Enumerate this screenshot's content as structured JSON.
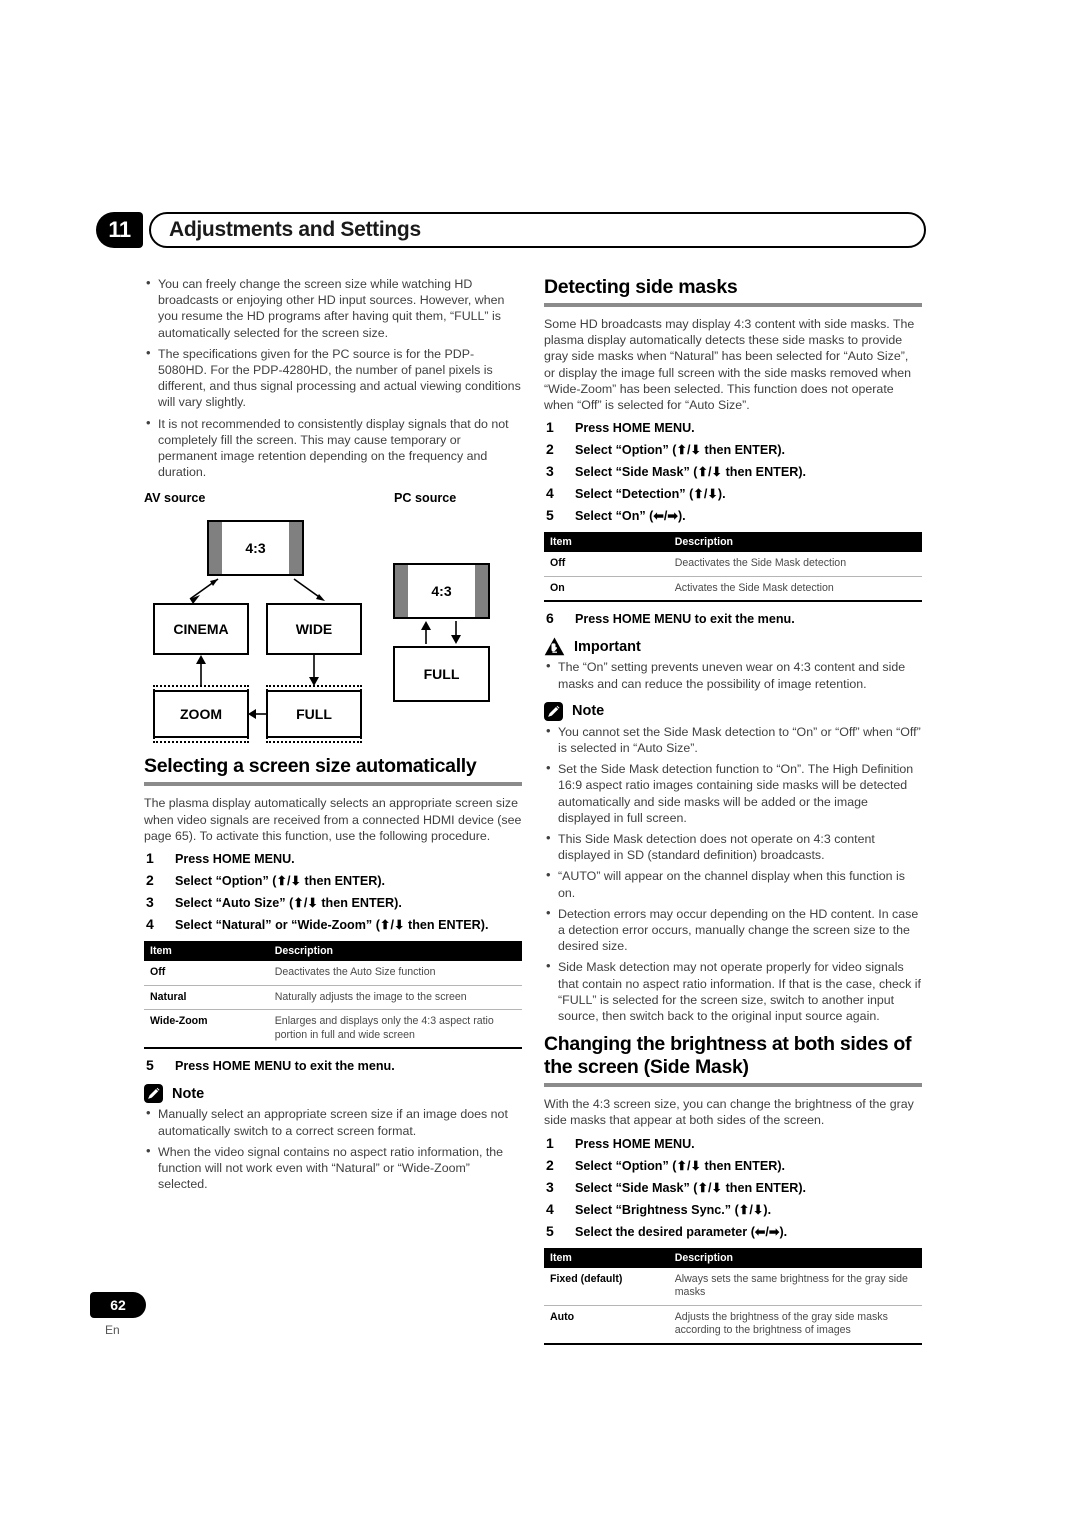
{
  "header": {
    "chapter_number": "11",
    "chapter_title": "Adjustments and Settings"
  },
  "left_column": {
    "intro_bullets": [
      "You can freely change the screen size while watching HD broadcasts or enjoying other HD input sources. However, when you resume the HD programs after having quit them, “FULL” is automatically selected for the screen size.",
      "The specifications given for the PC source is for the PDP-5080HD. For the PDP-4280HD, the number of panel pixels is different, and thus signal processing and actual viewing conditions will vary slightly.",
      "It is not recommended to consistently display signals that do not completely fill the screen. This may cause temporary or permanent image retention depending on the frequency and duration."
    ],
    "diagram": {
      "av_source_label": "AV source",
      "pc_source_label": "PC source",
      "av_ratio_box": "4:3",
      "av_boxes": [
        "CINEMA",
        "WIDE",
        "ZOOM",
        "FULL"
      ],
      "pc_ratio_box": "4:3",
      "pc_box": "FULL"
    },
    "section": {
      "title": "Selecting a screen size automatically",
      "intro": "The plasma display automatically selects an appropriate screen size when video signals are received from a connected HDMI device (see page 65). To activate this function, use the following procedure.",
      "steps": [
        {
          "num": "1",
          "text": "Press HOME MENU."
        },
        {
          "num": "2",
          "text": "Select “Option” (⬆/⬇ then ENTER)."
        },
        {
          "num": "3",
          "text": "Select “Auto Size” (⬆/⬇ then ENTER)."
        },
        {
          "num": "4",
          "text": "Select “Natural” or “Wide-Zoom” (⬆/⬇ then ENTER)."
        }
      ],
      "table": {
        "headers": [
          "Item",
          "Description"
        ],
        "rows": [
          [
            "Off",
            "Deactivates the Auto Size function"
          ],
          [
            "Natural",
            "Naturally adjusts the image to the screen"
          ],
          [
            "Wide-Zoom",
            "Enlarges and displays only the 4:3 aspect ratio portion in full and wide screen"
          ]
        ]
      },
      "final_step": {
        "num": "5",
        "text": "Press HOME MENU to exit the menu."
      }
    },
    "note": {
      "label": "Note",
      "bullets": [
        "Manually select an appropriate screen size if an image does not automatically switch to a correct screen format.",
        "When the video signal contains no aspect ratio information, the function will not work even with “Natural” or “Wide-Zoom” selected."
      ]
    }
  },
  "right_column": {
    "section1": {
      "title": "Detecting side masks",
      "intro": "Some HD broadcasts may display 4:3 content with side masks. The plasma display automatically detects these side masks to provide gray side masks when “Natural” has been selected for “Auto Size”, or display the image full screen with the side masks removed when “Wide-Zoom” has been selected. This function does not operate when “Off” is selected for “Auto Size”.",
      "steps": [
        {
          "num": "1",
          "text": "Press HOME MENU."
        },
        {
          "num": "2",
          "text": "Select “Option” (⬆/⬇ then ENTER)."
        },
        {
          "num": "3",
          "text": "Select “Side Mask” (⬆/⬇ then ENTER)."
        },
        {
          "num": "4",
          "text": "Select “Detection” (⬆/⬇)."
        },
        {
          "num": "5",
          "text": "Select “On” (⬅/➡)."
        }
      ],
      "table": {
        "headers": [
          "Item",
          "Description"
        ],
        "rows": [
          [
            "Off",
            "Deactivates the Side Mask detection"
          ],
          [
            "On",
            "Activates the Side Mask detection"
          ]
        ]
      },
      "final_step": {
        "num": "6",
        "text": "Press HOME MENU to exit the menu."
      }
    },
    "important": {
      "label": "Important",
      "bullets": [
        "The “On” setting prevents uneven wear on 4:3 content and side masks and can reduce the possibility of image retention."
      ]
    },
    "note": {
      "label": "Note",
      "bullets": [
        "You cannot set the Side Mask detection to “On” or “Off” when “Off” is selected in “Auto Size”.",
        "Set the Side Mask detection function to “On”. The High Definition 16:9 aspect ratio images containing side masks will be detected automatically and side masks will be added or the image displayed in full screen.",
        "This Side Mask detection does not operate on 4:3 content displayed in SD (standard definition) broadcasts.",
        "“AUTO” will appear on the channel display when this function is on.",
        "Detection errors may occur depending on the HD content. In case a detection error occurs, manually change the screen size to the desired size.",
        "Side Mask detection may not operate properly for video signals that contain no aspect ratio information. If that is the case, check if “FULL” is selected for the screen size, switch to another input source, then switch back to the original input source again."
      ]
    },
    "section2": {
      "title": "Changing the brightness at both sides of the screen (Side Mask)",
      "intro": "With the 4:3 screen size, you can change the brightness of the gray side masks that appear at both sides of the screen.",
      "steps": [
        {
          "num": "1",
          "text": "Press HOME MENU."
        },
        {
          "num": "2",
          "text": "Select “Option” (⬆/⬇ then ENTER)."
        },
        {
          "num": "3",
          "text": "Select “Side Mask” (⬆/⬇ then ENTER)."
        },
        {
          "num": "4",
          "text": "Select “Brightness Sync.” (⬆/⬇)."
        },
        {
          "num": "5",
          "text": "Select the desired parameter (⬅/➡)."
        }
      ],
      "table": {
        "headers": [
          "Item",
          "Description"
        ],
        "rows": [
          [
            "Fixed (default)",
            "Always sets the same brightness for the gray side masks"
          ],
          [
            "Auto",
            "Adjusts the brightness of the gray side masks according to the brightness of images"
          ]
        ]
      }
    }
  },
  "footer": {
    "page_number": "62",
    "language": "En"
  }
}
